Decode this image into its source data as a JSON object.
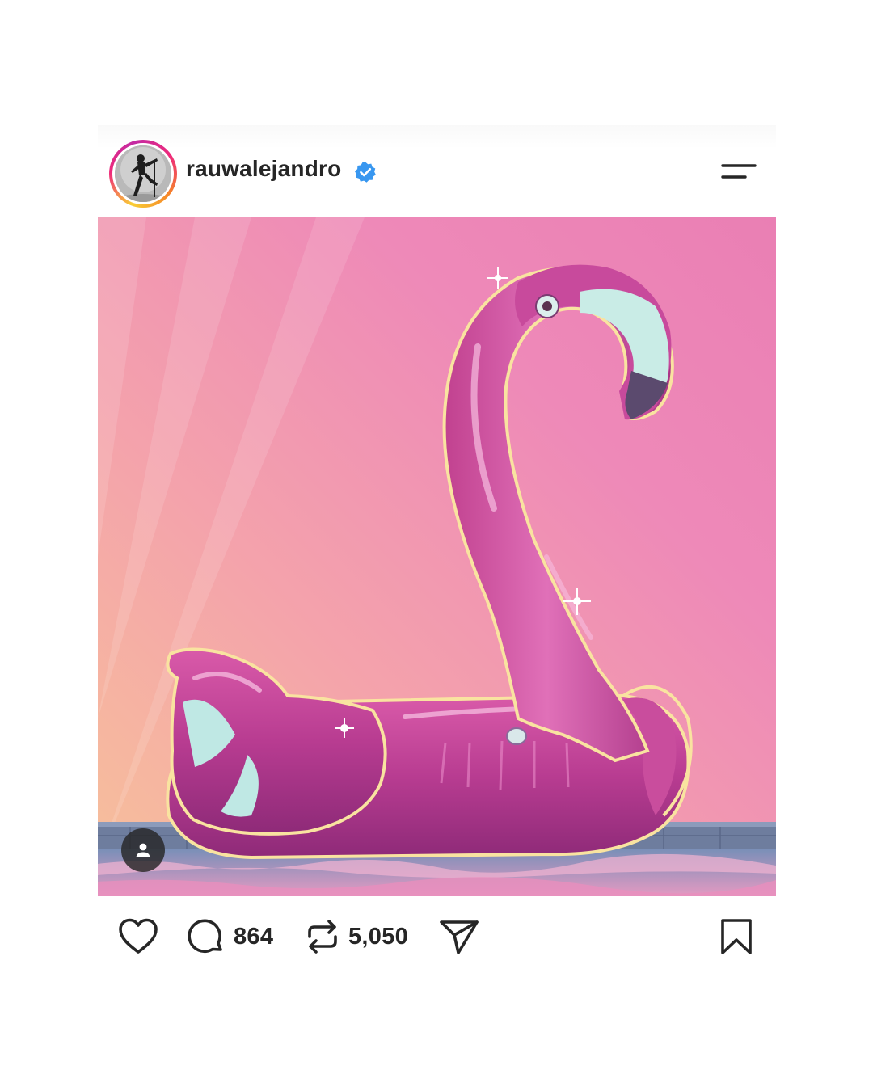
{
  "post": {
    "author": {
      "username": "rauwalejandro",
      "verified": true,
      "avatar_icon": "avatar-photo"
    },
    "menu_icon": "menu-icon",
    "image": {
      "description_icon": "inflatable-flamingo-artwork",
      "tag_icon": "user-tag-icon"
    },
    "actions": {
      "like_icon": "heart-icon",
      "comment_icon": "comment-bubble-icon",
      "comment_count": "864",
      "repost_icon": "repost-icon",
      "repost_count": "5,050",
      "share_icon": "send-icon",
      "save_icon": "bookmark-icon"
    }
  },
  "colors": {
    "text": "#262626",
    "verified_blue": "#3897f0",
    "background": "#ffffff"
  }
}
